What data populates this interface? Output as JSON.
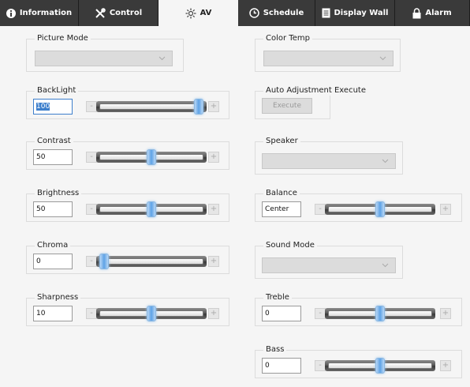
{
  "tabs": [
    {
      "label": "Information",
      "icon": "info-icon"
    },
    {
      "label": "Control",
      "icon": "tools-icon"
    },
    {
      "label": "AV",
      "icon": "sun-icon"
    },
    {
      "label": "Schedule",
      "icon": "clock-icon"
    },
    {
      "label": "Display Wall",
      "icon": "document-icon"
    },
    {
      "label": "Alarm",
      "icon": "lock-icon"
    }
  ],
  "active_tab": "AV",
  "picture_mode": {
    "label": "Picture Mode",
    "value": ""
  },
  "color_temp": {
    "label": "Color Temp",
    "value": ""
  },
  "backlight": {
    "label": "BackLight",
    "value": "100",
    "level": 1.0
  },
  "auto_adjust": {
    "label": "Auto Adjustment Execute",
    "button": "Execute"
  },
  "contrast": {
    "label": "Contrast",
    "value": "50",
    "level": 0.5
  },
  "speaker": {
    "label": "Speaker",
    "value": ""
  },
  "brightness": {
    "label": "Brightness",
    "value": "50",
    "level": 0.5
  },
  "balance": {
    "label": "Balance",
    "value": "Center",
    "level": 0.5
  },
  "chroma": {
    "label": "Chroma",
    "value": "0",
    "level": 0.0
  },
  "sound_mode": {
    "label": "Sound Mode",
    "value": ""
  },
  "sharpness": {
    "label": "Sharpness",
    "value": "10",
    "level": 0.5
  },
  "treble": {
    "label": "Treble",
    "value": "0",
    "level": 0.5
  },
  "bass": {
    "label": "Bass",
    "value": "0",
    "level": 0.5
  },
  "minus_label": "-",
  "plus_label": "+",
  "colors": {
    "tab_bg": "#3a3a3a",
    "thumb": "#5ea3e6",
    "focus": "#3d7fcc"
  }
}
